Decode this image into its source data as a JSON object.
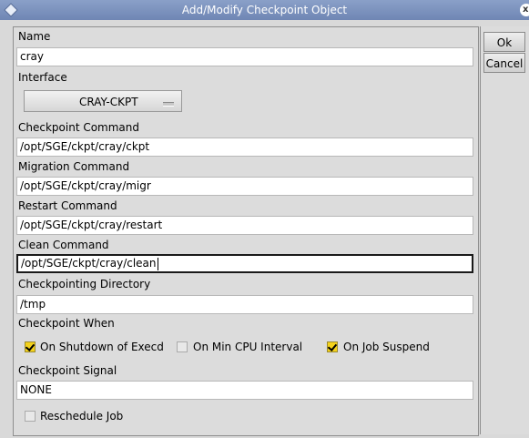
{
  "window": {
    "title": "Add/Modify Checkpoint Object",
    "close_glyph": "x"
  },
  "actions": {
    "ok_label": "Ok",
    "cancel_label": "Cancel"
  },
  "form": {
    "name": {
      "label": "Name",
      "value": "cray"
    },
    "interface": {
      "label": "Interface",
      "selected": "CRAY-CKPT"
    },
    "checkpoint_command": {
      "label": "Checkpoint Command",
      "value": "/opt/SGE/ckpt/cray/ckpt"
    },
    "migration_command": {
      "label": "Migration Command",
      "value": "/opt/SGE/ckpt/cray/migr"
    },
    "restart_command": {
      "label": "Restart Command",
      "value": "/opt/SGE/ckpt/cray/restart"
    },
    "clean_command": {
      "label": "Clean Command",
      "value": "/opt/SGE/ckpt/cray/clean"
    },
    "checkpointing_directory": {
      "label": "Checkpointing Directory",
      "value": "/tmp"
    },
    "checkpoint_when": {
      "label": "Checkpoint When",
      "options": [
        {
          "label": "On Shutdown of Execd",
          "checked": true
        },
        {
          "label": "On Min CPU Interval",
          "checked": false
        },
        {
          "label": "On Job Suspend",
          "checked": true
        }
      ]
    },
    "checkpoint_signal": {
      "label": "Checkpoint Signal",
      "value": "NONE"
    },
    "reschedule_job": {
      "label": "Reschedule Job",
      "checked": false
    }
  },
  "icons": {
    "window_menu": "diamond-icon",
    "close": "close-icon"
  },
  "colors": {
    "titlebar": "#7b91bd",
    "check_on": "#f3d11b"
  }
}
